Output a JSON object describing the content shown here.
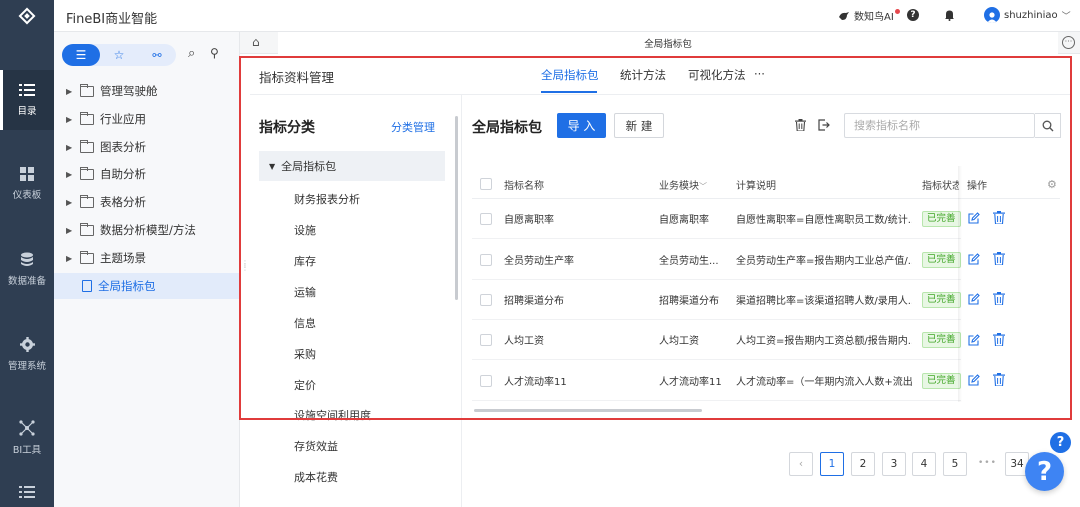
{
  "app": {
    "name": "FineBI商业智能",
    "user": "shuzhiniao",
    "ai_label": "数知鸟AI"
  },
  "leftnav": {
    "items": [
      {
        "label": "目录",
        "icon": "list-icon"
      },
      {
        "label": "仪表板",
        "icon": "dashboard-icon"
      },
      {
        "label": "数据准备",
        "icon": "database-icon"
      },
      {
        "label": "管理系统",
        "icon": "gear-icon"
      },
      {
        "label": "BI工具",
        "icon": "network-icon"
      },
      {
        "label": "",
        "icon": "list-icon"
      }
    ]
  },
  "tree": {
    "items": [
      {
        "label": "管理驾驶舱"
      },
      {
        "label": "行业应用"
      },
      {
        "label": "图表分析"
      },
      {
        "label": "自助分析"
      },
      {
        "label": "表格分析"
      },
      {
        "label": "数据分析模型/方法"
      },
      {
        "label": "主题场景"
      },
      {
        "label": "全局指标包"
      }
    ]
  },
  "breadcrumb": {
    "tab": "全局指标包"
  },
  "page": {
    "title": "指标资料管理",
    "tabs": [
      "全局指标包",
      "统计方法",
      "可视化方法"
    ],
    "more": "···"
  },
  "category": {
    "title": "指标分类",
    "manage": "分类管理",
    "selected": "全局指标包",
    "items": [
      "财务报表分析",
      "设施",
      "库存",
      "运输",
      "信息",
      "采购",
      "定价",
      "设施空间利用度",
      "存货效益",
      "成本花费"
    ]
  },
  "package": {
    "title": "全局指标包",
    "import_label": "导 入",
    "new_label": "新 建",
    "search_placeholder": "搜索指标名称"
  },
  "table": {
    "headers": {
      "name": "指标名称",
      "module": "业务模块",
      "calc": "计算说明",
      "status": "指标状态",
      "ops": "操作"
    },
    "rows": [
      {
        "name": "自愿离职率",
        "module": "自愿离职率",
        "calc": "自愿性离职率=自愿性离职员工数/统计...",
        "status": "已完善"
      },
      {
        "name": "全员劳动生产率",
        "module": "全员劳动生...",
        "calc": "全员劳动生产率=报告期内工业总产值/...",
        "status": "已完善"
      },
      {
        "name": "招聘渠道分布",
        "module": "招聘渠道分布",
        "calc": "渠道招聘比率=该渠道招聘人数/录用人...",
        "status": "已完善"
      },
      {
        "name": "人均工资",
        "module": "人均工资",
        "calc": "人均工资=报告期内工资总额/报告期内...",
        "status": "已完善"
      },
      {
        "name": "人才流动率11",
        "module": "人才流动率11",
        "calc": "人才流动率=（一年期内流入人数+流出...",
        "status": "已完善"
      }
    ]
  },
  "pagination": {
    "pages": [
      "1",
      "2",
      "3",
      "4",
      "5"
    ],
    "ellipsis": "•••",
    "last": "34",
    "current": "1"
  },
  "colors": {
    "accent": "#1f6fe5",
    "sidebar": "#2f3e52",
    "highlight_frame": "#e03b3b",
    "status_green": "#40a626"
  }
}
